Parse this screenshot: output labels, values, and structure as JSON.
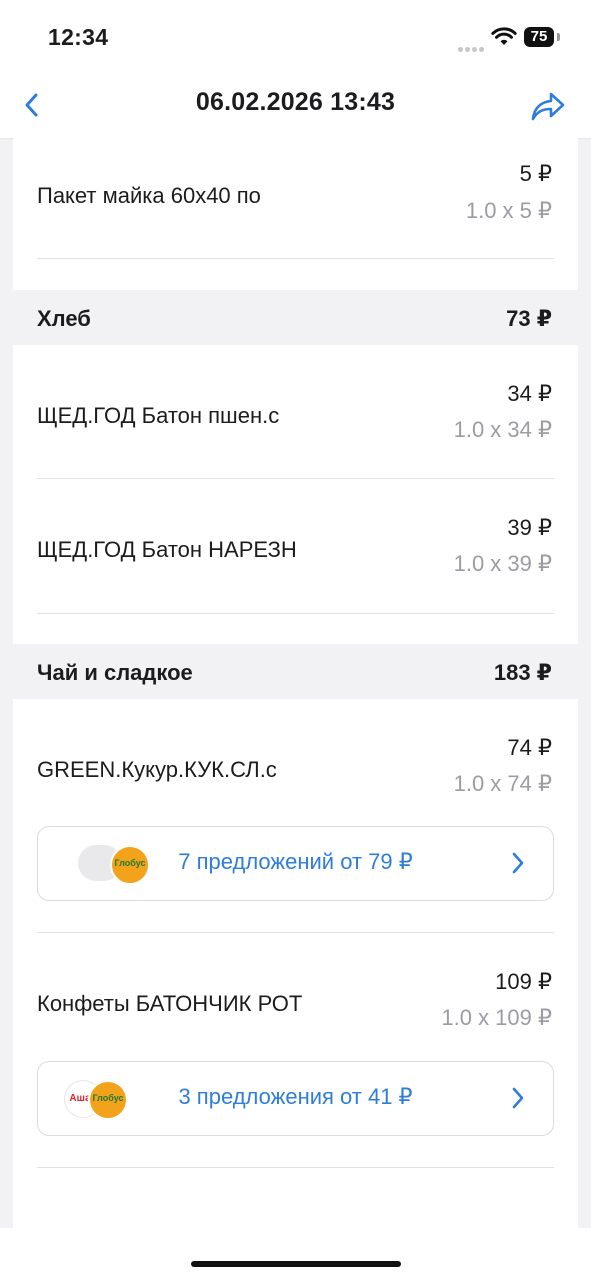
{
  "status_bar": {
    "time": "12:34",
    "battery": "75"
  },
  "nav": {
    "title": "06.02.2026 13:43"
  },
  "items_top": [
    {
      "name": "Пакет майка 60х40 по",
      "price": "5 ₽",
      "qty": "1.0 x 5 ₽"
    }
  ],
  "sections": [
    {
      "title": "Хлеб",
      "total": "73 ₽",
      "items": [
        {
          "name": "ЩЕД.ГОД Батон пшен.с",
          "price": "34 ₽",
          "qty": "1.0 x 34 ₽"
        },
        {
          "name": "ЩЕД.ГОД Батон НАРЕЗН",
          "price": "39 ₽",
          "qty": "1.0 x 39 ₽"
        }
      ]
    },
    {
      "title": "Чай и сладкое",
      "total": "183 ₽",
      "items": [
        {
          "name": "GREEN.Кукур.КУК.СЛ.с",
          "price": "74 ₽",
          "qty": "1.0 x 74 ₽",
          "offer": "7 предложений от 79 ₽"
        },
        {
          "name": "Конфеты БАТОНЧИК РОТ",
          "price": "109 ₽",
          "qty": "1.0 x 109 ₽",
          "offer": "3 предложения от 41 ₽"
        }
      ]
    }
  ],
  "logos": {
    "ashan": "Ашан",
    "globus": "Глобус"
  },
  "colors": {
    "accent": "#2f7ddb",
    "muted": "#9c9ca3",
    "section_bg": "#f2f2f5"
  },
  "icons": {
    "back": "chevron-left-icon",
    "share": "share-arrow-icon",
    "offer": "chevron-right-icon"
  }
}
